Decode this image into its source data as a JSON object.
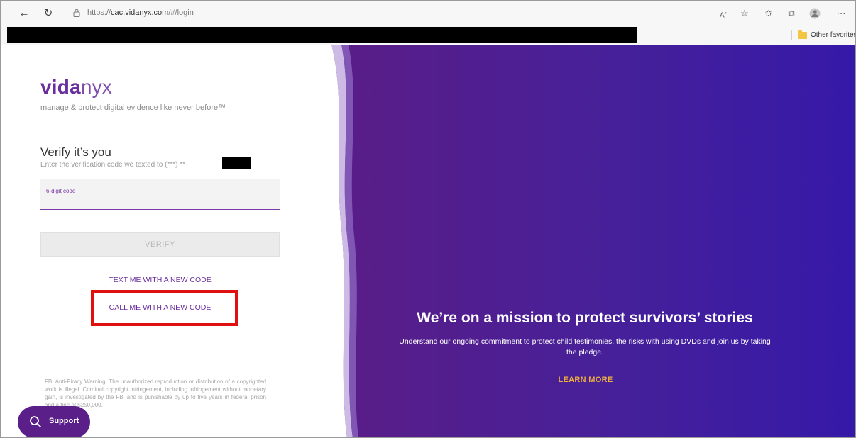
{
  "browser": {
    "url_prefix": "https://",
    "url_host": "cac.vidanyx.com",
    "url_path": "/#/login",
    "bookmark_folder": "Other favorites"
  },
  "brand": {
    "logo_bold": "vida",
    "logo_light": "nyx",
    "tagline": "manage & protect digital evidence like never before™"
  },
  "verify": {
    "title": "Verify it’s you",
    "subtitle": "Enter the verification code we texted to (***) **",
    "code_label": "6-digit code",
    "verify_button": "VERIFY",
    "text_link": "TEXT ME WITH A NEW CODE",
    "call_link": "CALL ME WITH A NEW CODE"
  },
  "warning": "FBI Anti-Piracy Warning: The unauthorized reproduction or distribution of a copyrighted work is illegal. Criminal copyright infringement, including infringement without monetary gain, is investigated by the FBI and is punishable by up to five years in federal prison and a fine of $250,000.",
  "support": {
    "label": "Support"
  },
  "hero": {
    "title": "We’re on a mission to protect survivors’ stories",
    "body": "Understand our ongoing commitment to protect child testimonies, the risks with using DVDs and join us by taking the pledge.",
    "cta": "LEARN MORE"
  },
  "colors": {
    "brand_purple": "#6a2f9e",
    "hero_gradient_start": "#5a1d86",
    "hero_gradient_end": "#3519a8",
    "cta_gold": "#f2b13c",
    "highlight_red": "#e01010"
  }
}
